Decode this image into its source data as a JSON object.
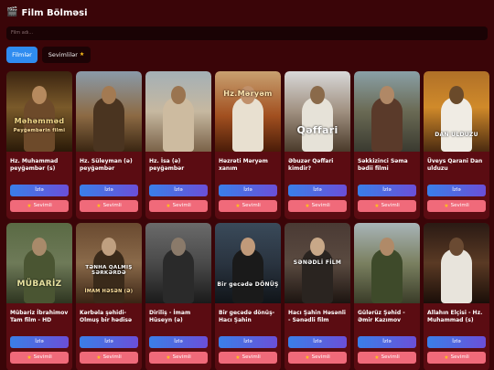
{
  "header": {
    "icon": "clapper-board-icon",
    "title": "Film Bölməsi"
  },
  "search": {
    "placeholder": "Film adı..."
  },
  "tabs": [
    {
      "label": "Filmlər",
      "active": true
    },
    {
      "label": "Sevimlilər",
      "icon": "star-icon",
      "active": false
    }
  ],
  "buttons": {
    "watch": "İzlə",
    "favorite": "Sevimli"
  },
  "movies": [
    {
      "title": "Hz. Muhammad peyğəmbər (s)",
      "poster_text": "Məhəmməd",
      "poster_sub": "Peyğəmbərin filmi"
    },
    {
      "title": "Hz. Süleyman (ə) peyğəmbər",
      "poster_text": "",
      "poster_sub": ""
    },
    {
      "title": "Hz. İsa (ə) peyğəmbər",
      "poster_text": "",
      "poster_sub": ""
    },
    {
      "title": "Həzrəti Məryəm xanım",
      "poster_text": "Hz.Məryəm",
      "poster_sub": ""
    },
    {
      "title": "Əbuzər Qəffari kimdir?",
      "poster_text": "Qəffari",
      "poster_sub": ""
    },
    {
      "title": "Səkkizinci Səma bədii filmi",
      "poster_text": "",
      "poster_sub": ""
    },
    {
      "title": "Üveys Qarani Dan ulduzu",
      "poster_text": "DAN ULDUZU",
      "poster_sub": ""
    },
    {
      "title": "Mübariz İbrahimov Tam film - HD",
      "poster_text": "MÜBARİZ",
      "poster_sub": ""
    },
    {
      "title": "Kərbəla şəhidi-Olmuş bir hədisə",
      "poster_text": "TƏNHA QALMIŞ SƏRKƏRDƏ",
      "poster_sub": "İMAM HƏSƏN (Ə)"
    },
    {
      "title": "Diriliş - İmam Hüseyn (ə)",
      "poster_text": "",
      "poster_sub": ""
    },
    {
      "title": "Bir gecədə dönüş-Hacı Şahin",
      "poster_text": "Bir gecədə DÖNÜŞ",
      "poster_sub": ""
    },
    {
      "title": "Hacı Şahin Həsənli - Sənədli film",
      "poster_text": "SƏNƏDLİ FİLM",
      "poster_sub": ""
    },
    {
      "title": "Gülərüz Şəhid - Əmir Kazımov",
      "poster_text": "",
      "poster_sub": ""
    },
    {
      "title": "Allahın Elçisi - Hz. Muhammad (s)",
      "poster_text": "",
      "poster_sub": ""
    }
  ],
  "colors": {
    "background": "#3a0508",
    "card": "#5b0c12",
    "watch_button": "#3a7fe8",
    "favorite_button": "#f06a7a",
    "active_tab": "#2f8cf0"
  }
}
